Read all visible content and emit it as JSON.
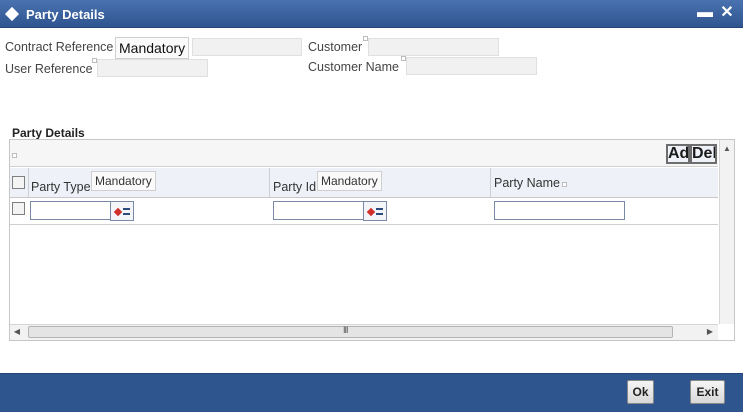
{
  "window": {
    "title": "Party Details",
    "minimize_label": "▬",
    "close_label": "✕"
  },
  "header_fields": {
    "contract_reference": {
      "label": "Contract Reference",
      "hint": "Mandatory"
    },
    "user_reference": {
      "label": "User Reference"
    },
    "customer": {
      "label": "Customer"
    },
    "customer_name": {
      "label": "Customer Name"
    }
  },
  "party_section": {
    "title": "Party Details",
    "add_label": "Add",
    "delete_label": "Delete",
    "columns": [
      {
        "label": "Party Type",
        "hint": "Mandatory"
      },
      {
        "label": "Party Id",
        "hint": "Mandatory"
      },
      {
        "label": "Party Name"
      }
    ],
    "rows": [
      {
        "party_type": "",
        "party_id": "",
        "party_name": ""
      }
    ],
    "scroll_middle_label": "III"
  },
  "footer": {
    "ok_label": "Ok",
    "exit_label": "Exit"
  },
  "colors": {
    "titlebar": "#2f558f",
    "footer": "#2f558f",
    "header_row": "#eef2f8"
  }
}
